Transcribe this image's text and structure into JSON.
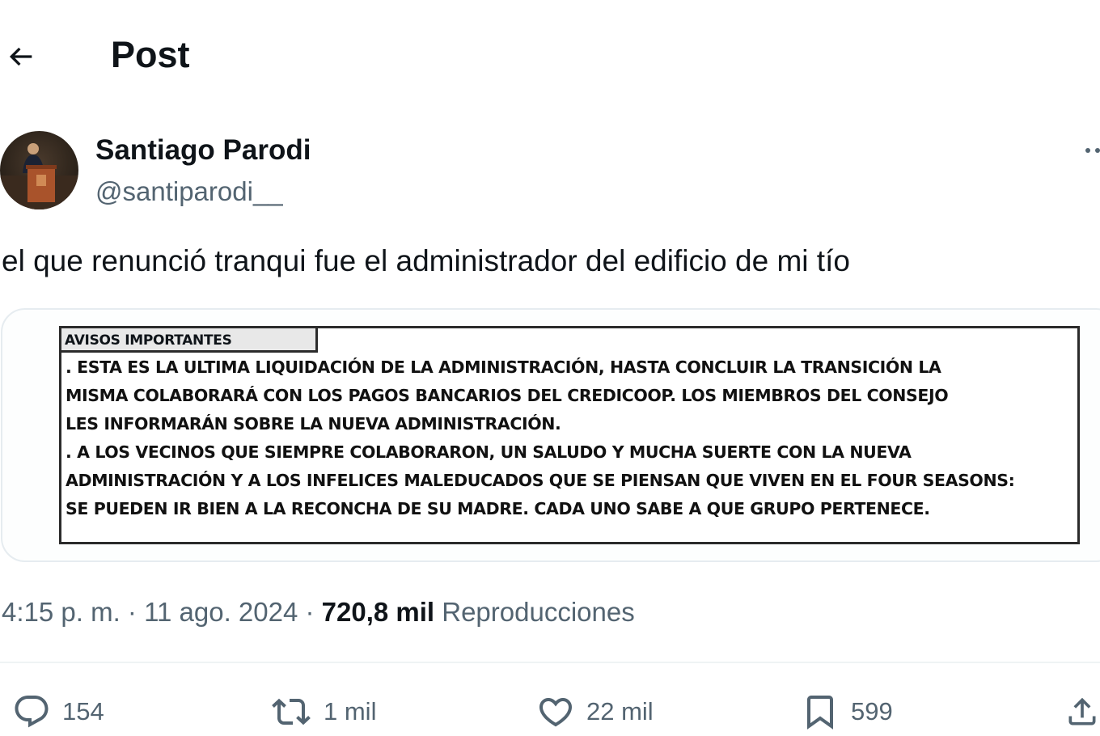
{
  "header": {
    "title": "Post",
    "back_icon": "arrow-left-icon"
  },
  "author": {
    "name": "Santiago Parodi",
    "handle": "@santiparodi__"
  },
  "post": {
    "text": "el que renunció tranqui fue el administrador del edificio de mi tío"
  },
  "media": {
    "notice_title": "AVISOS IMPORTANTES",
    "lines": [
      ". ESTA ES LA ULTIMA LIQUIDACIÓN DE LA ADMINISTRACIÓN, HASTA CONCLUIR LA TRANSICIÓN LA",
      "MISMA COLABORARÁ CON LOS PAGOS BANCARIOS DEL CREDICOOP. LOS MIEMBROS DEL CONSEJO",
      "LES INFORMARÁN SOBRE LA NUEVA ADMINISTRACIÓN.",
      ". A LOS VECINOS QUE SIEMPRE COLABORARON, UN SALUDO Y MUCHA SUERTE CON LA NUEVA",
      "ADMINISTRACIÓN Y A LOS INFELICES MALEDUCADOS QUE SE PIENSAN QUE VIVEN EN EL FOUR SEASONS:",
      "SE PUEDEN IR BIEN A LA RECONCHA DE SU MADRE. CADA UNO SABE A QUE GRUPO PERTENECE."
    ]
  },
  "meta": {
    "time": "4:15 p. m.",
    "separator": " · ",
    "date": "11 ago. 2024",
    "views": "720,8 mil",
    "views_label": "Reproducciones"
  },
  "actions": {
    "replies": "154",
    "retweets": "1 mil",
    "likes": "22 mil",
    "bookmarks": "599"
  },
  "colors": {
    "text": "#0f1419",
    "secondary": "#536471",
    "border": "#eff3f4"
  }
}
